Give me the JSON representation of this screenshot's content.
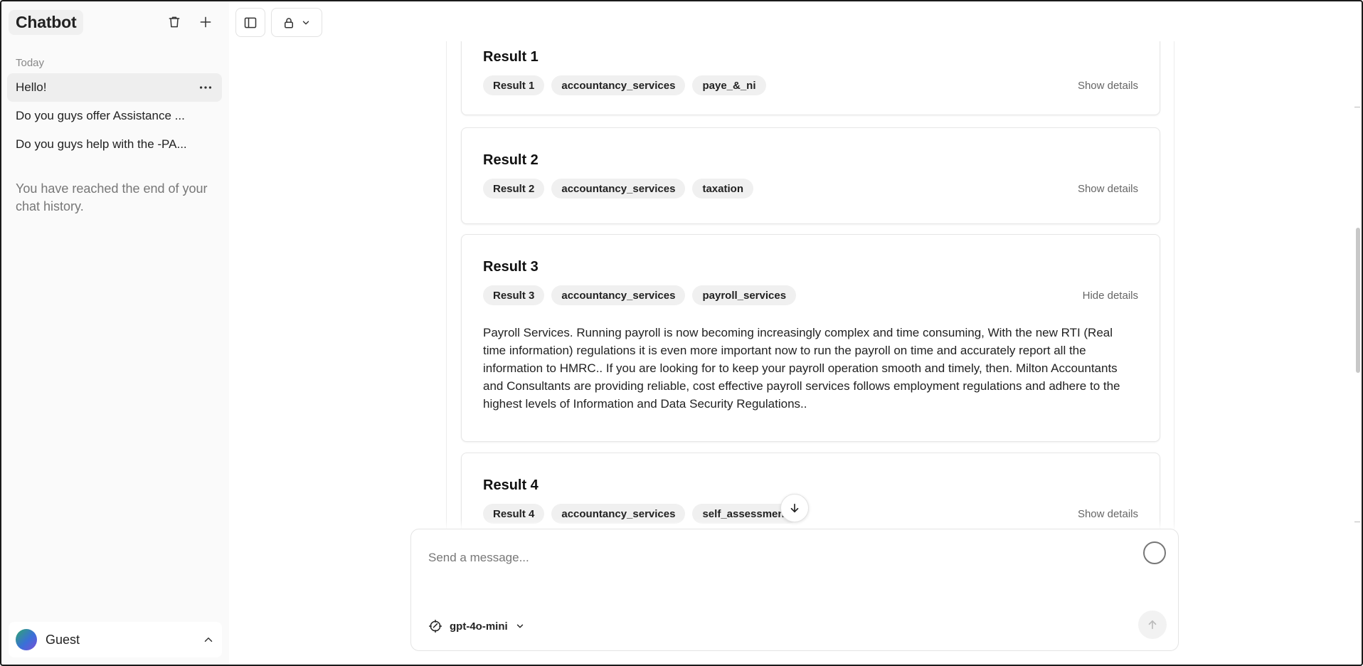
{
  "sidebar": {
    "title": "Chatbot",
    "section_label": "Today",
    "chats": [
      {
        "label": "Hello!",
        "active": true
      },
      {
        "label": "Do you guys offer Assistance ...",
        "active": false
      },
      {
        "label": "Do you guys help with the -PA...",
        "active": false
      }
    ],
    "history_end": "You have reached the end of your chat history.",
    "user": {
      "name": "Guest"
    }
  },
  "results": [
    {
      "title": "Result 1",
      "tags": [
        "Result 1",
        "accountancy_services",
        "paye_&_ni"
      ],
      "toggle_label": "Show details"
    },
    {
      "title": "Result 2",
      "tags": [
        "Result 2",
        "accountancy_services",
        "taxation"
      ],
      "toggle_label": "Show details"
    },
    {
      "title": "Result 3",
      "tags": [
        "Result 3",
        "accountancy_services",
        "payroll_services"
      ],
      "toggle_label": "Hide details",
      "body": "Payroll Services. Running payroll is now becoming increasingly complex and time consuming, With the new RTI (Real time information) regulations it is even more important now to run the payroll on time and accurately report all the information to HMRC.. If you are looking for to keep your payroll operation smooth and timely, then. Milton Accountants and Consultants are providing reliable, cost effective payroll services follows employment regulations and adhere to the highest levels of Information and Data Security Regulations.."
    },
    {
      "title": "Result 4",
      "tags": [
        "Result 4",
        "accountancy_services",
        "self_assessment"
      ],
      "toggle_label": "Show details"
    }
  ],
  "composer": {
    "placeholder": "Send a message...",
    "model": "gpt-4o-mini"
  },
  "icons": {
    "delete": "trash-icon",
    "new_chat": "plus-icon",
    "sidebar_toggle": "sidebar-toggle-icon",
    "visibility": "lock-icon",
    "menu": "more-horizontal-icon",
    "user_menu": "chevron-up-icon",
    "scroll": "arrow-down-icon",
    "send": "arrow-up-icon",
    "model": "model-icon"
  }
}
